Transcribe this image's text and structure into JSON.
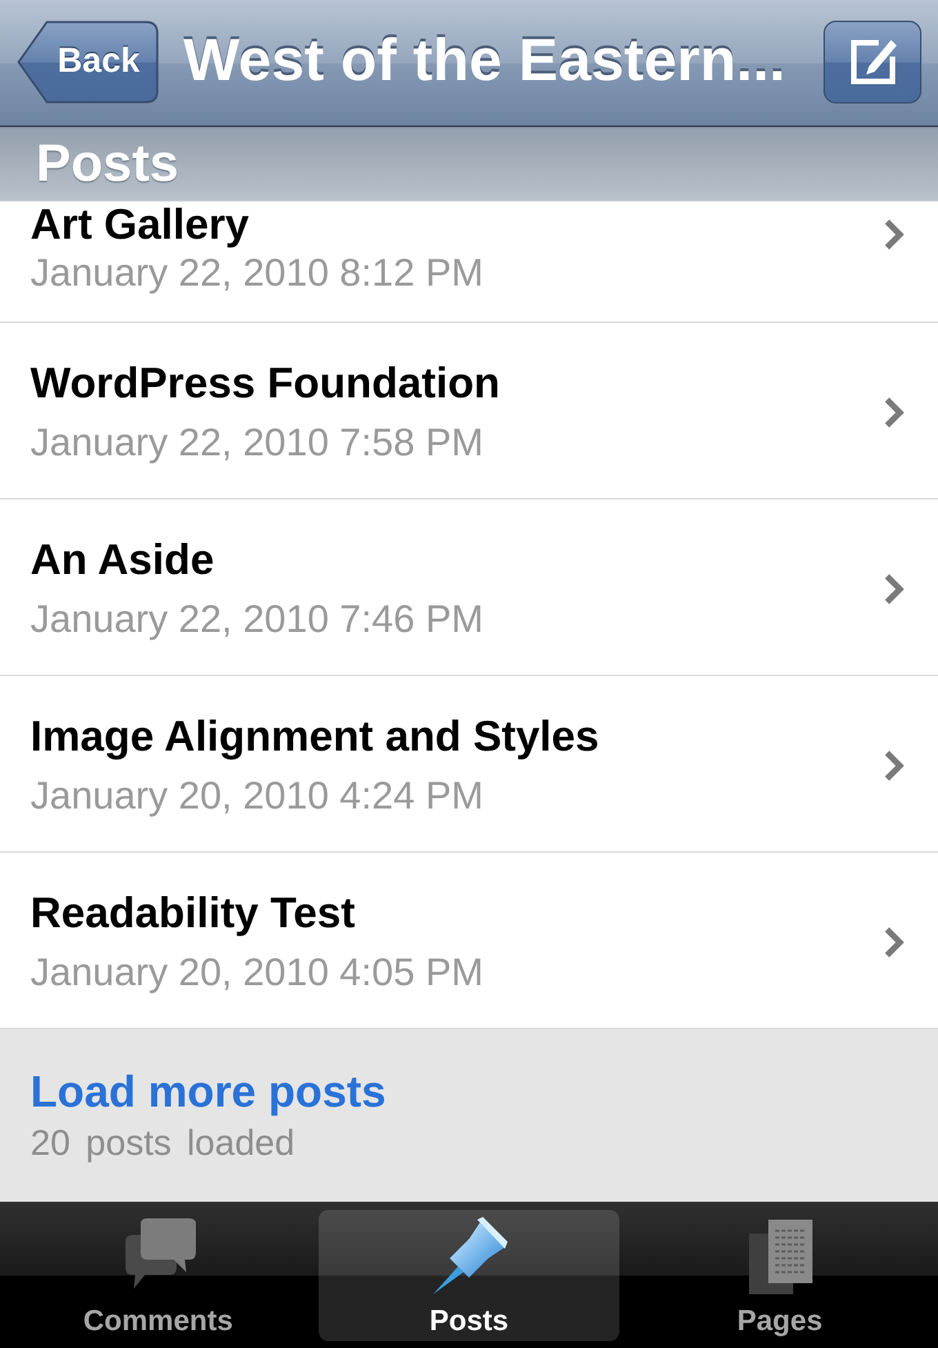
{
  "nav_bar": {
    "back_button": "Back",
    "title": "West of the Eastern..."
  },
  "section_header": "Posts",
  "posts": [
    {
      "title": "Art Gallery",
      "date": "January 22, 2010 8:12 PM"
    },
    {
      "title": "WordPress Foundation",
      "date": "January 22, 2010 7:58 PM"
    },
    {
      "title": "An Aside",
      "date": "January 22, 2010 7:46 PM"
    },
    {
      "title": "Image Alignment and Styles",
      "date": "January 20, 2010 4:24 PM"
    },
    {
      "title": "Readability Test",
      "date": "January 20, 2010 4:05 PM"
    }
  ],
  "load_more": {
    "label": "Load more posts",
    "status": "20 posts loaded"
  },
  "tab_bar": [
    {
      "label": "Comments",
      "kind": "comments",
      "selected": false
    },
    {
      "label": "Posts",
      "kind": "posts",
      "selected": true
    },
    {
      "label": "Pages",
      "kind": "pages",
      "selected": false
    }
  ]
}
